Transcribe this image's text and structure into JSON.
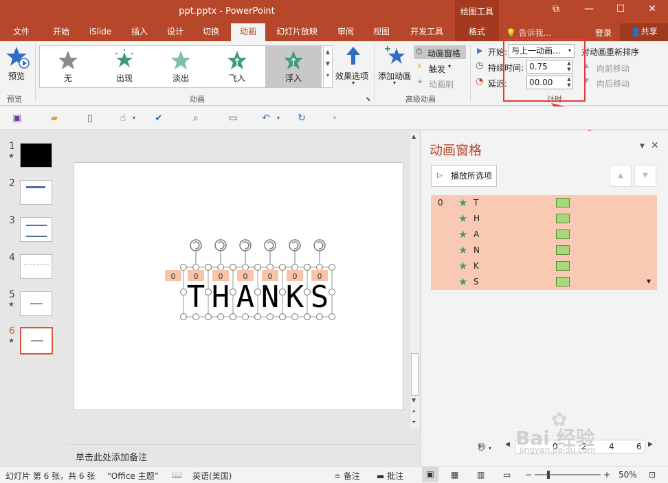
{
  "titlebar": {
    "title": "ppt.pptx - PowerPoint",
    "context_group": "绘图工具"
  },
  "tabs": [
    {
      "label": "文件"
    },
    {
      "label": "开始"
    },
    {
      "label": "iSlide"
    },
    {
      "label": "插入"
    },
    {
      "label": "设计"
    },
    {
      "label": "切换"
    },
    {
      "label": "动画"
    },
    {
      "label": "幻灯片放映"
    },
    {
      "label": "审阅"
    },
    {
      "label": "视图"
    },
    {
      "label": "开发工具"
    },
    {
      "label": "格式"
    }
  ],
  "tellme": "告诉我...",
  "login": "登录",
  "share": "共享",
  "ribbon": {
    "preview": {
      "label": "预览",
      "group": "预览"
    },
    "gallery": [
      {
        "label": "无"
      },
      {
        "label": "出现"
      },
      {
        "label": "淡出"
      },
      {
        "label": "飞入"
      },
      {
        "label": "浮入"
      }
    ],
    "effect_options": "效果选项",
    "animation_group": "动画",
    "add_animation": "添加动画",
    "animation_pane": "动画窗格",
    "trigger": "触发",
    "animation_painter": "动画刷",
    "advanced_group": "高级动画",
    "start_label": "开始:",
    "start_value": "与上一动画...",
    "duration_label": "持续时间:",
    "duration_value": "0.75",
    "delay_label": "延迟:",
    "delay_value": "00.00",
    "reorder_title": "对动画重新排序",
    "move_earlier": "向前移动",
    "move_later": "向后移动",
    "timing_group": "计时"
  },
  "slides": [
    {
      "num": "1",
      "star": "★"
    },
    {
      "num": "2",
      "star": ""
    },
    {
      "num": "3",
      "star": ""
    },
    {
      "num": "4",
      "star": ""
    },
    {
      "num": "5",
      "star": "★"
    },
    {
      "num": "6",
      "star": "★"
    }
  ],
  "slide_content": {
    "letters": [
      "T",
      "H",
      "A",
      "N",
      "K",
      "S"
    ],
    "tags": [
      "0",
      "0",
      "0",
      "0",
      "0",
      "0"
    ]
  },
  "notes_placeholder": "单击此处添加备注",
  "pane": {
    "title": "动画窗格",
    "play_button": "播放所选项",
    "items": [
      {
        "index": "0",
        "name": "T"
      },
      {
        "index": "",
        "name": "H"
      },
      {
        "index": "",
        "name": "A"
      },
      {
        "index": "",
        "name": "N"
      },
      {
        "index": "",
        "name": "K"
      },
      {
        "index": "",
        "name": "S"
      }
    ],
    "seconds_label": "秒",
    "timeline_ticks": [
      "0",
      "2",
      "4",
      "6"
    ]
  },
  "status": {
    "slide_info": "幻灯片 第 6 张，共 6 张",
    "theme": "“Office 主题”",
    "language": "英语(美国)",
    "notes": "备注",
    "comments": "批注",
    "zoom": "50%"
  },
  "watermark": {
    "line1": "Bai 经验",
    "line2": "jingyan.baidu.com"
  },
  "colors": {
    "accent": "#b7472a",
    "anim_list_bg": "#f9c9b3",
    "highlight": "#e53a3a"
  }
}
